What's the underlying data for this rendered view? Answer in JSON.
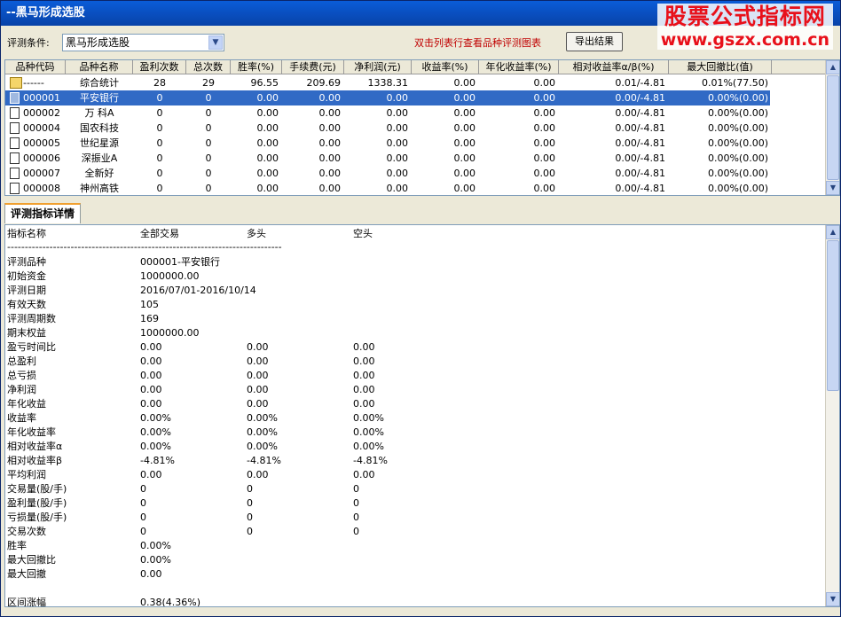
{
  "title": "--黑马形成选股",
  "watermark": {
    "line1": "股票公式指标网",
    "line2": "www.gszx.com.cn"
  },
  "toolbar": {
    "condition_label": "评测条件:",
    "condition_value": "黑马形成选股",
    "hint": "双击列表行查看品种评测图表",
    "export_label": "导出结果"
  },
  "grid": {
    "columns": [
      "品种代码",
      "品种名称",
      "盈利次数",
      "总次数",
      "胜率(%)",
      "手续费(元)",
      "净利润(元)",
      "收益率(%)",
      "年化收益率(%)",
      "相对收益率α/β(%)",
      "最大回撤比(值)"
    ],
    "rows": [
      {
        "code": "------",
        "name": "综合统计",
        "wins": "28",
        "total": "29",
        "winrate": "96.55",
        "fee": "209.69",
        "profit": "1338.31",
        "yield": "0.00",
        "annual": "0.00",
        "relative": "0.01/-4.81",
        "drawdown": "0.01%(77.50)",
        "icon": "stat",
        "selected": false
      },
      {
        "code": "000001",
        "name": "平安银行",
        "wins": "0",
        "total": "0",
        "winrate": "0.00",
        "fee": "0.00",
        "profit": "0.00",
        "yield": "0.00",
        "annual": "0.00",
        "relative": "0.00/-4.81",
        "drawdown": "0.00%(0.00)",
        "icon": "doc",
        "selected": true
      },
      {
        "code": "000002",
        "name": "万 科A",
        "wins": "0",
        "total": "0",
        "winrate": "0.00",
        "fee": "0.00",
        "profit": "0.00",
        "yield": "0.00",
        "annual": "0.00",
        "relative": "0.00/-4.81",
        "drawdown": "0.00%(0.00)",
        "icon": "doc",
        "selected": false
      },
      {
        "code": "000004",
        "name": "国农科技",
        "wins": "0",
        "total": "0",
        "winrate": "0.00",
        "fee": "0.00",
        "profit": "0.00",
        "yield": "0.00",
        "annual": "0.00",
        "relative": "0.00/-4.81",
        "drawdown": "0.00%(0.00)",
        "icon": "doc",
        "selected": false
      },
      {
        "code": "000005",
        "name": "世纪星源",
        "wins": "0",
        "total": "0",
        "winrate": "0.00",
        "fee": "0.00",
        "profit": "0.00",
        "yield": "0.00",
        "annual": "0.00",
        "relative": "0.00/-4.81",
        "drawdown": "0.00%(0.00)",
        "icon": "doc",
        "selected": false
      },
      {
        "code": "000006",
        "name": "深振业A",
        "wins": "0",
        "total": "0",
        "winrate": "0.00",
        "fee": "0.00",
        "profit": "0.00",
        "yield": "0.00",
        "annual": "0.00",
        "relative": "0.00/-4.81",
        "drawdown": "0.00%(0.00)",
        "icon": "doc",
        "selected": false
      },
      {
        "code": "000007",
        "name": "全新好",
        "wins": "0",
        "total": "0",
        "winrate": "0.00",
        "fee": "0.00",
        "profit": "0.00",
        "yield": "0.00",
        "annual": "0.00",
        "relative": "0.00/-4.81",
        "drawdown": "0.00%(0.00)",
        "icon": "doc",
        "selected": false
      },
      {
        "code": "000008",
        "name": "神州高铁",
        "wins": "0",
        "total": "0",
        "winrate": "0.00",
        "fee": "0.00",
        "profit": "0.00",
        "yield": "0.00",
        "annual": "0.00",
        "relative": "0.00/-4.81",
        "drawdown": "0.00%(0.00)",
        "icon": "doc",
        "selected": false
      }
    ]
  },
  "tab": {
    "label": "评测指标详情"
  },
  "detail": {
    "headers": [
      "指标名称",
      "全部交易",
      "多头",
      "空头"
    ],
    "separator": "------------------------------------------------------------------------------",
    "rows": [
      [
        "评测品种",
        "000001-平安银行",
        "",
        ""
      ],
      [
        "初始资金",
        "1000000.00",
        "",
        ""
      ],
      [
        "评测日期",
        "2016/07/01-2016/10/14",
        "",
        ""
      ],
      [
        "有效天数",
        "105",
        "",
        ""
      ],
      [
        "评测周期数",
        "169",
        "",
        ""
      ],
      [
        "期末权益",
        "1000000.00",
        "",
        ""
      ],
      [
        "盈亏时间比",
        "0.00",
        "0.00",
        "0.00"
      ],
      [
        "总盈利",
        "0.00",
        "0.00",
        "0.00"
      ],
      [
        "总亏损",
        "0.00",
        "0.00",
        "0.00"
      ],
      [
        "净利润",
        "0.00",
        "0.00",
        "0.00"
      ],
      [
        "年化收益",
        "0.00",
        "0.00",
        "0.00"
      ],
      [
        "收益率",
        "0.00%",
        "0.00%",
        "0.00%"
      ],
      [
        "年化收益率",
        "0.00%",
        "0.00%",
        "0.00%"
      ],
      [
        "相对收益率α",
        "0.00%",
        "0.00%",
        "0.00%"
      ],
      [
        "相对收益率β",
        "-4.81%",
        "-4.81%",
        "-4.81%"
      ],
      [
        "平均利润",
        "0.00",
        "0.00",
        "0.00"
      ],
      [
        "交易量(股/手)",
        "0",
        "0",
        "0"
      ],
      [
        "盈利量(股/手)",
        "0",
        "0",
        "0"
      ],
      [
        "亏损量(股/手)",
        "0",
        "0",
        "0"
      ],
      [
        "交易次数",
        "0",
        "0",
        "0"
      ],
      [
        "胜率",
        "0.00%",
        "",
        ""
      ],
      [
        "最大回撤比",
        "0.00%",
        "",
        ""
      ],
      [
        "最大回撤",
        "0.00",
        "",
        ""
      ],
      [
        "",
        "",
        "",
        ""
      ],
      [
        "区间涨幅",
        "0.38(4.36%)",
        "",
        ""
      ]
    ]
  },
  "colors": {
    "title_bg": "#0a5cd8",
    "selected_row": "#316ac5",
    "hint_text": "#c00000",
    "watermark": "#e8101a",
    "tab_accent": "#f0a030"
  },
  "icons": {
    "dropdown": "chevron-down-icon",
    "scroll_up": "arrow-up-icon",
    "scroll_down": "arrow-down-icon",
    "row_doc": "document-icon",
    "row_stat": "folder-icon"
  }
}
